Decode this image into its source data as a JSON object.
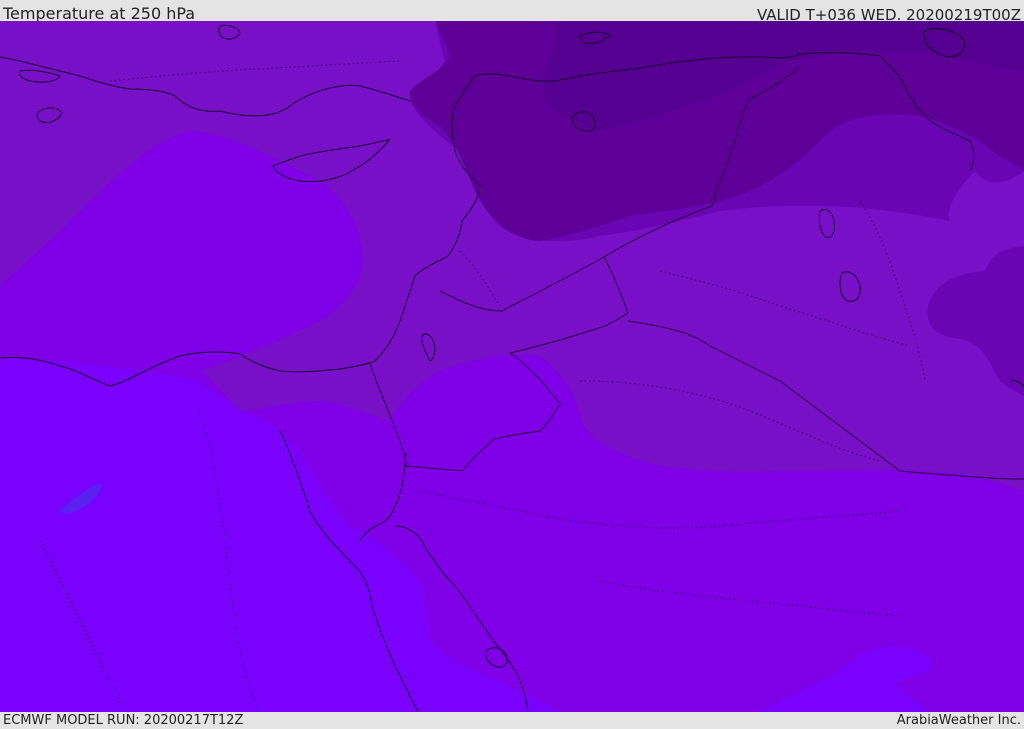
{
  "header": {
    "title": "Temperature at 250 hPa",
    "valid": "VALID T+036 WED. 20200219T00Z"
  },
  "footer": {
    "model_run": "ECMWF MODEL RUN: 20200217T12Z",
    "credit": "ArabiaWeather Inc."
  },
  "colors": {
    "band_warmest": "#7a00ff",
    "band_warm": "#7f00e6",
    "band_mid": "#7810c8",
    "band_cool": "#6a05b4",
    "band_cold": "#5e0098",
    "band_coldest": "#550090",
    "coast_line": "#1a0030",
    "border_line": "#2a0040"
  }
}
